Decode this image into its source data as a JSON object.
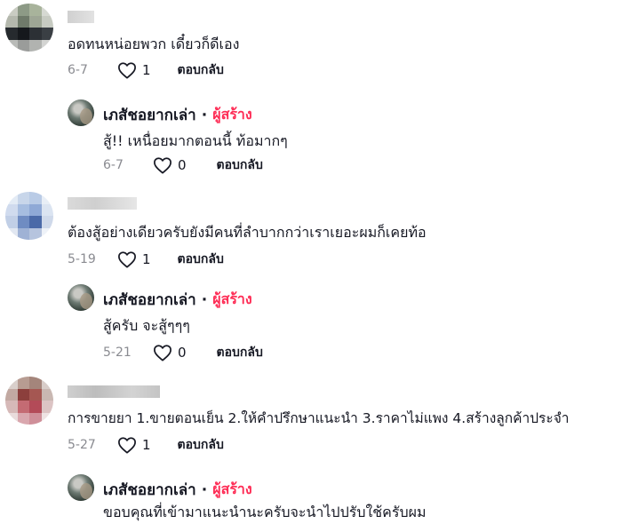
{
  "comments": [
    {
      "text": "อดทนหน่อยพวก เดี๋ยวก็ดีเอง",
      "date": "6-7",
      "likes": "1",
      "reply_label": "ตอบกลับ",
      "reply": {
        "author": "เภสัชอยากเล่า",
        "separator": "·",
        "creator_tag": "ผู้สร้าง",
        "text": "สู้!! เหนื่อยมากตอนนี้ ท้อมากๆ",
        "date": "6-7",
        "likes": "0",
        "reply_label": "ตอบกลับ"
      }
    },
    {
      "text": "ต้องสู้อย่างเดียวครับยังมีคนที่ลำบากกว่าเราเยอะผมก็เคยท้อ",
      "date": "5-19",
      "likes": "1",
      "reply_label": "ตอบกลับ",
      "reply": {
        "author": "เภสัชอยากเล่า",
        "separator": "·",
        "creator_tag": "ผู้สร้าง",
        "text": "สู้ครับ จะสู้ๆๆๆ",
        "date": "5-21",
        "likes": "0",
        "reply_label": "ตอบกลับ"
      }
    },
    {
      "text": "การขายยา 1.ขายตอนเย็น 2.ให้คำปรึกษาแนะนำ 3.ราคาไม่แพง 4.สร้างลูกค้าประจำ",
      "date": "5-27",
      "likes": "1",
      "reply_label": "ตอบกลับ",
      "reply": {
        "author": "เภสัชอยากเล่า",
        "separator": "·",
        "creator_tag": "ผู้สร้าง",
        "text": "ขอบคุณที่เข้ามาแนะนำนะครับจะนำไปปรับใช้ครับผม"
      }
    }
  ],
  "colors": {
    "creator_tag": "#fe2c55",
    "meta": "#8a8b91",
    "text": "#161823"
  },
  "icons": {
    "like": "heart-outline-icon"
  }
}
